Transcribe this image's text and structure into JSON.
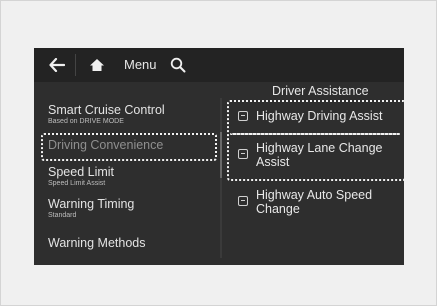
{
  "toolbar": {
    "back_icon": "arrow-left-icon",
    "home_icon": "home-icon",
    "menu_label": "Menu",
    "search_icon": "search-icon"
  },
  "section_title": "Driver Assistance",
  "left_menu": [
    {
      "label": "Smart Cruise Control",
      "sub": "Based on DRIVE MODE"
    },
    {
      "label": "Driving Convenience",
      "sub": ""
    },
    {
      "label": "Speed Limit",
      "sub": "Speed Limit Assist"
    },
    {
      "label": "Warning Timing",
      "sub": "Standard"
    },
    {
      "label": "Warning Methods",
      "sub": ""
    }
  ],
  "right_options": [
    {
      "label": "Highway Driving Assist",
      "checked": false
    },
    {
      "label": "Highway Lane Change Assist",
      "checked": false
    },
    {
      "label": "Highway Auto Speed Change",
      "checked": false
    }
  ],
  "colors": {
    "screen_bg": "#2e2e2e",
    "topbar_bg": "#232323",
    "text": "#e6e6e6",
    "highlight_outline": "#f2f2f2"
  }
}
